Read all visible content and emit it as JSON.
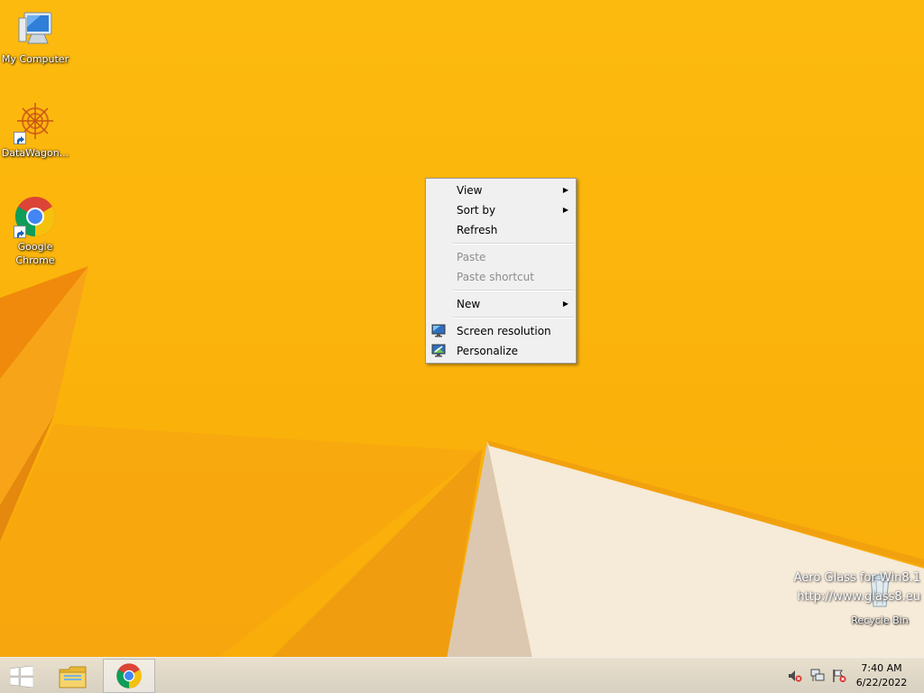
{
  "desktop": {
    "icons": [
      {
        "label": "My Computer",
        "icon": "computer-icon"
      },
      {
        "label": "DataWagon...",
        "icon": "datawagon-icon"
      },
      {
        "label": "Google Chrome",
        "icon": "chrome-icon"
      }
    ],
    "recycle_bin": {
      "label": "Recycle Bin",
      "icon": "recycle-bin-icon"
    },
    "watermark": {
      "line1": "Aero Glass for Win8.1",
      "line2": "http://www.glass8.eu"
    }
  },
  "context_menu": {
    "items": [
      {
        "label": "View",
        "submenu": true
      },
      {
        "label": "Sort by",
        "submenu": true
      },
      {
        "label": "Refresh"
      },
      {
        "label": "Paste",
        "disabled": true
      },
      {
        "label": "Paste shortcut",
        "disabled": true
      },
      {
        "label": "New",
        "submenu": true
      },
      {
        "label": "Screen resolution",
        "icon": "display-icon"
      },
      {
        "label": "Personalize",
        "icon": "personalize-icon"
      }
    ],
    "submenu_arrow": "▶"
  },
  "taskbar": {
    "pinned": [
      {
        "name": "start",
        "icon": "windows-logo-icon"
      },
      {
        "name": "file-explorer",
        "icon": "folder-icon"
      },
      {
        "name": "google-chrome",
        "icon": "chrome-icon",
        "active": true
      }
    ],
    "tray": {
      "icons": [
        "volume-muted-icon",
        "network-icon",
        "action-center-flag-icon"
      ],
      "time": "7:40 AM",
      "date": "6/22/2022"
    }
  },
  "colors": {
    "wallpaper": "#fbb40b",
    "menu_bg": "#f0f0f0",
    "disabled_text": "#8d8d8d"
  }
}
